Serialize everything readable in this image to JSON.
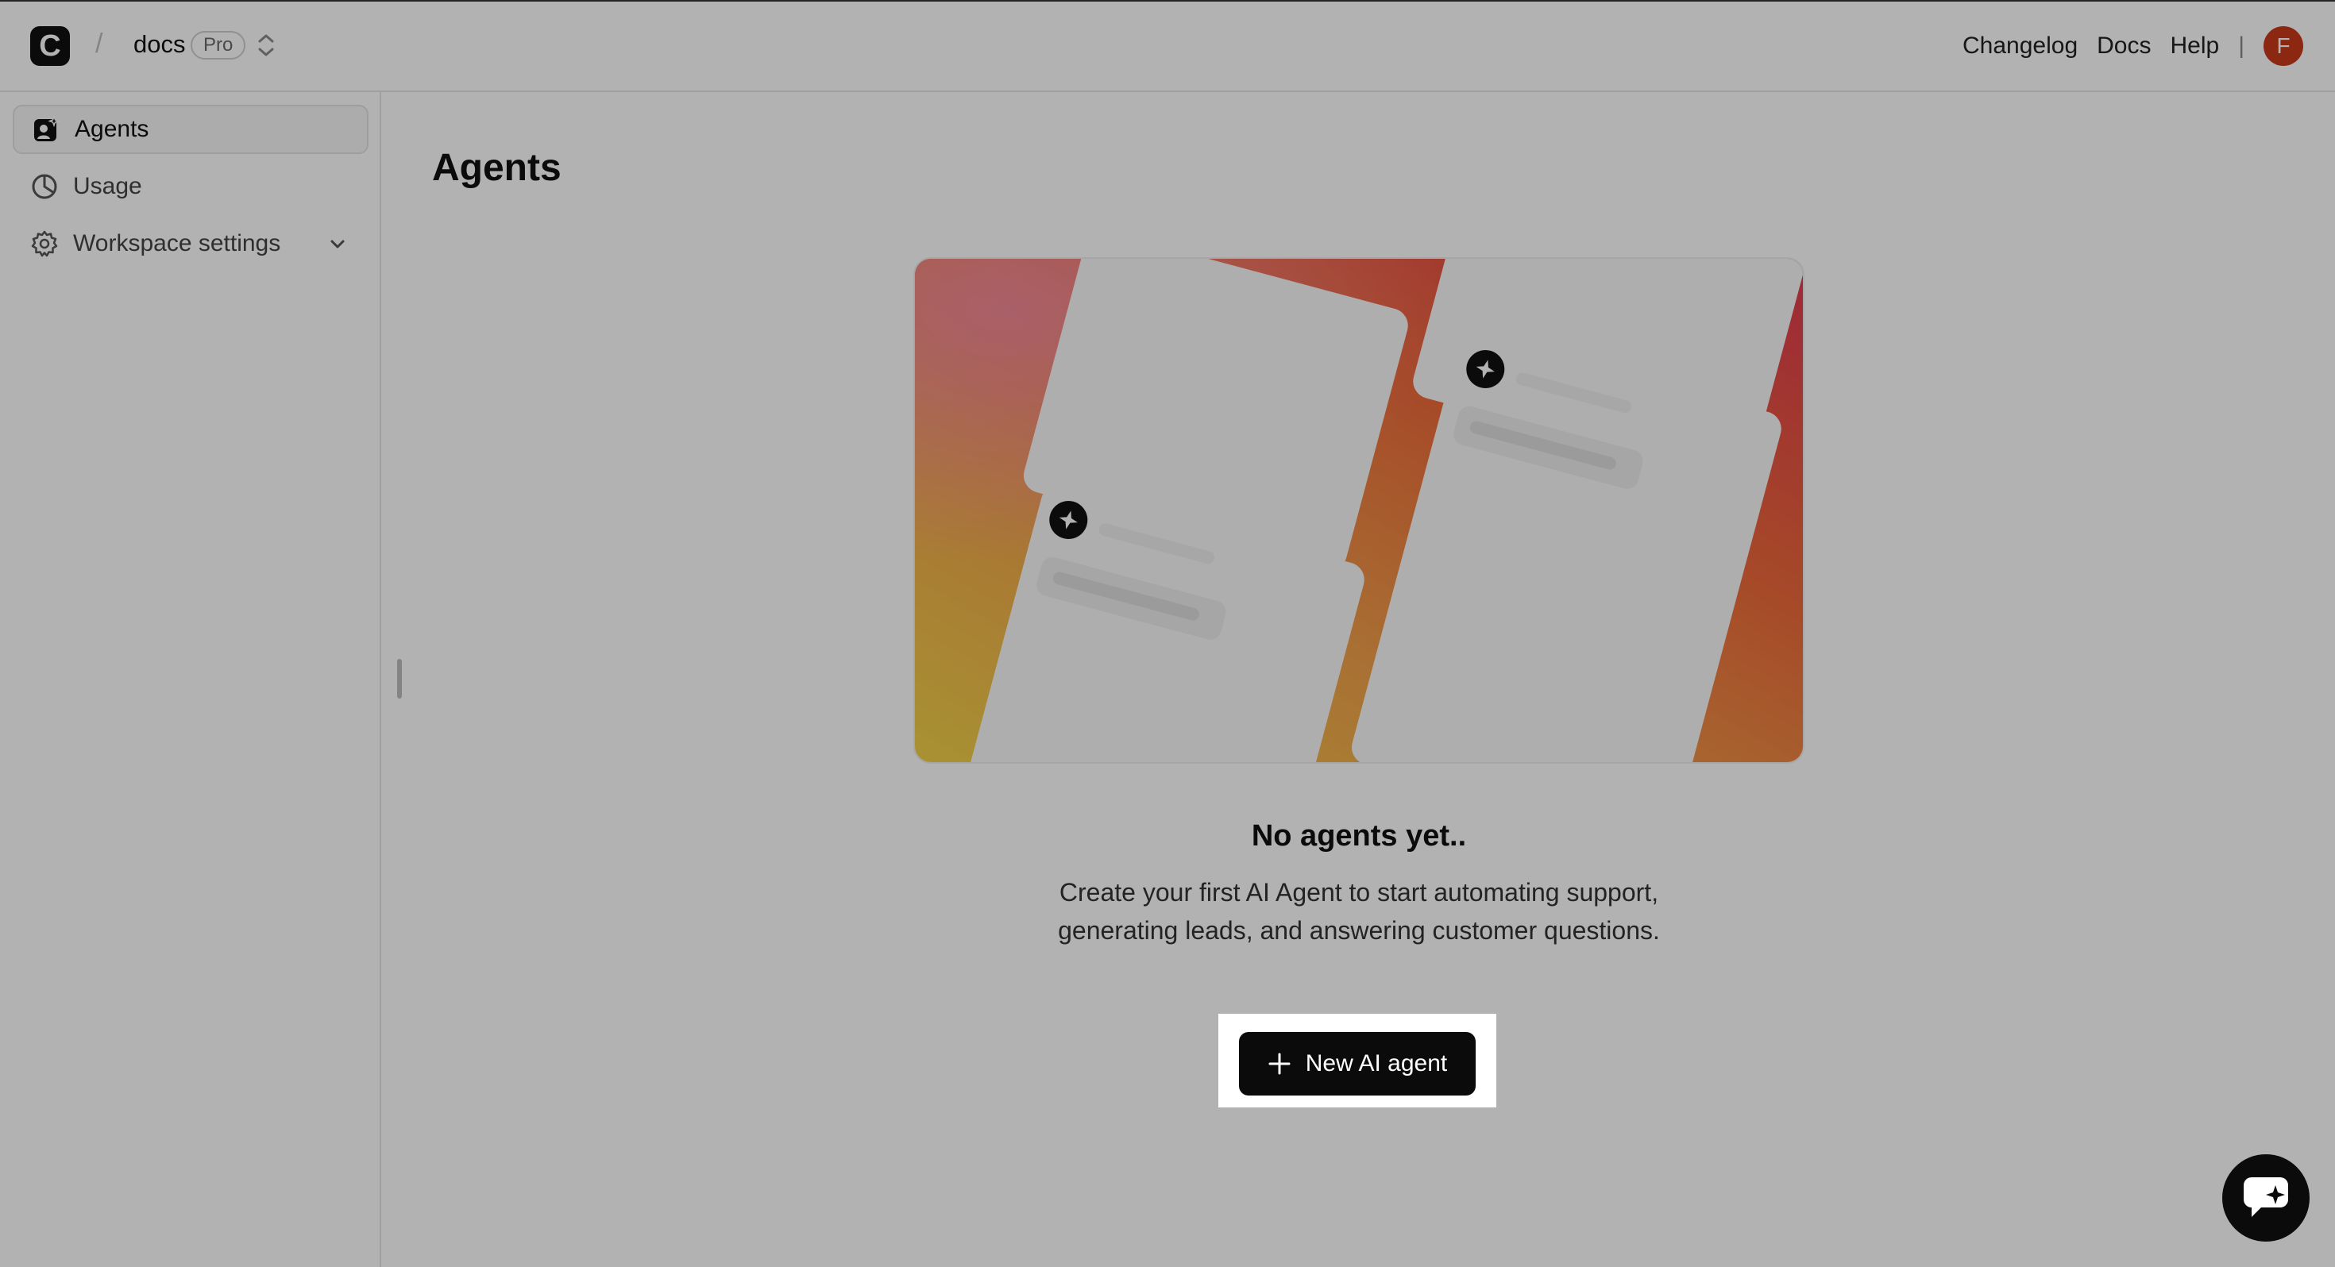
{
  "header": {
    "logo_letter": "C",
    "breadcrumb_separator": "/",
    "workspace_name": "docs",
    "plan_badge": "Pro",
    "nav_links": [
      "Changelog",
      "Docs",
      "Help"
    ],
    "nav_separator": "|",
    "avatar_initial": "F",
    "avatar_color": "#c9391b"
  },
  "sidebar": {
    "items": [
      {
        "label": "Agents",
        "icon": "agents-icon",
        "active": true
      },
      {
        "label": "Usage",
        "icon": "usage-pie-icon",
        "active": false
      },
      {
        "label": "Workspace settings",
        "icon": "gear-icon",
        "active": false,
        "expandable": true
      }
    ]
  },
  "main": {
    "title": "Agents",
    "empty_state": {
      "heading": "No agents yet..",
      "text_line1": "Create your first AI Agent to start automating support,",
      "text_line2": "generating leads, and answering customer questions.",
      "button_label": "New AI agent"
    }
  },
  "colors": {
    "primary_button": "#0b0b0b",
    "overlay": "rgba(0,0,0,0.30)"
  }
}
